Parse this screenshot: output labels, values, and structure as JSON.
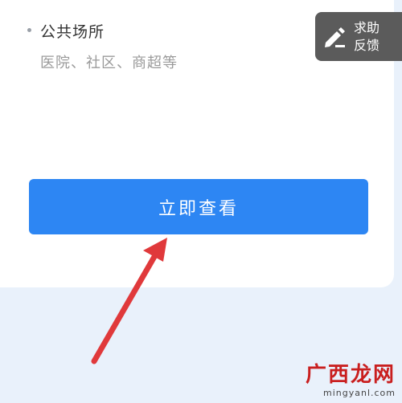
{
  "item": {
    "title": "公共场所",
    "description": "医院、社区、商超等"
  },
  "primary_button": {
    "label": "立即查看"
  },
  "help_feedback": {
    "line1": "求助",
    "line2": "反馈"
  },
  "watermark": {
    "logo": "广西龙网",
    "domain": "mingyanl.com"
  },
  "colors": {
    "primary": "#2d86f3",
    "arrow": "#e0393b",
    "page_bg": "#e9f1fb",
    "help_bg": "#5b5b5b"
  }
}
